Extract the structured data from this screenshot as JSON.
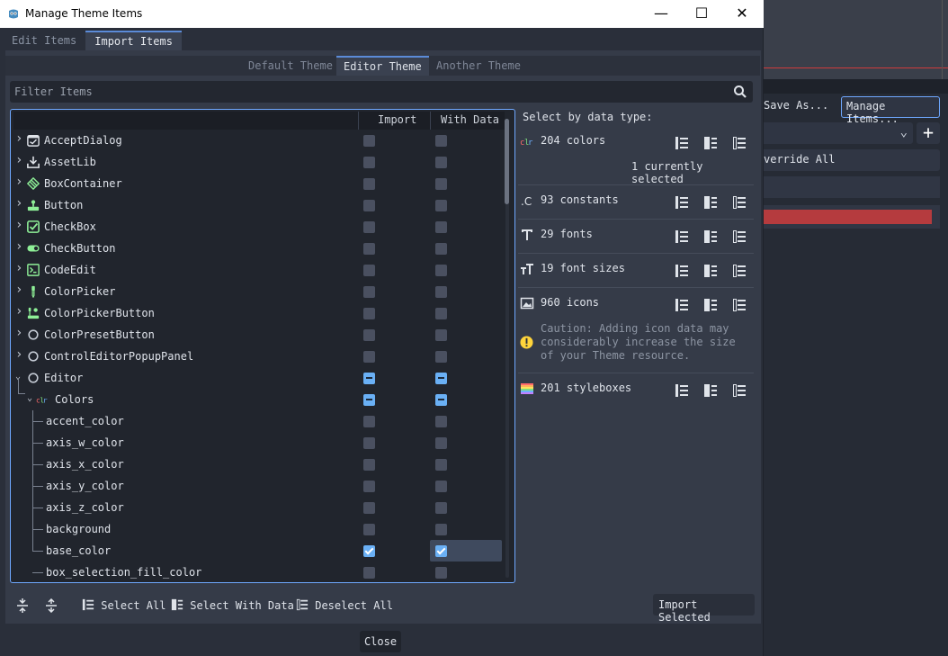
{
  "window": {
    "title": "Manage Theme Items"
  },
  "main_tabs": [
    {
      "label": "Edit Items",
      "active": false
    },
    {
      "label": "Import Items",
      "active": true
    }
  ],
  "theme_tabs": [
    {
      "label": "Default Theme",
      "active": false
    },
    {
      "label": "Editor Theme",
      "active": true
    },
    {
      "label": "Another Theme",
      "active": false
    }
  ],
  "filter": {
    "placeholder": "Filter Items"
  },
  "tree": {
    "columns": {
      "import": "Import",
      "with_data": "With Data"
    },
    "rows": [
      {
        "label": "AcceptDialog",
        "icon": "accept-dialog-icon",
        "import": "unchecked",
        "with_data": "unchecked"
      },
      {
        "label": "AssetLib",
        "icon": "asset-lib-icon",
        "import": "unchecked",
        "with_data": "unchecked"
      },
      {
        "label": "BoxContainer",
        "icon": "box-container-icon",
        "import": "unchecked",
        "with_data": "unchecked"
      },
      {
        "label": "Button",
        "icon": "button-icon",
        "import": "unchecked",
        "with_data": "unchecked"
      },
      {
        "label": "CheckBox",
        "icon": "checkbox-icon",
        "import": "unchecked",
        "with_data": "unchecked"
      },
      {
        "label": "CheckButton",
        "icon": "check-button-icon",
        "import": "unchecked",
        "with_data": "unchecked"
      },
      {
        "label": "CodeEdit",
        "icon": "code-edit-icon",
        "import": "unchecked",
        "with_data": "unchecked"
      },
      {
        "label": "ColorPicker",
        "icon": "color-picker-icon",
        "import": "unchecked",
        "with_data": "unchecked"
      },
      {
        "label": "ColorPickerButton",
        "icon": "color-picker-button-icon",
        "import": "unchecked",
        "with_data": "unchecked"
      },
      {
        "label": "ColorPresetButton",
        "icon": "circle-icon",
        "import": "unchecked",
        "with_data": "unchecked"
      },
      {
        "label": "ControlEditorPopupPanel",
        "icon": "circle-icon",
        "import": "unchecked",
        "with_data": "unchecked"
      },
      {
        "label": "Editor",
        "icon": "circle-icon",
        "import": "mixed",
        "with_data": "mixed"
      },
      {
        "label": "Colors",
        "icon": "colors-icon",
        "import": "mixed",
        "with_data": "mixed"
      },
      {
        "label": "accent_color",
        "import": "unchecked",
        "with_data": "unchecked"
      },
      {
        "label": "axis_w_color",
        "import": "unchecked",
        "with_data": "unchecked"
      },
      {
        "label": "axis_x_color",
        "import": "unchecked",
        "with_data": "unchecked"
      },
      {
        "label": "axis_y_color",
        "import": "unchecked",
        "with_data": "unchecked"
      },
      {
        "label": "axis_z_color",
        "import": "unchecked",
        "with_data": "unchecked"
      },
      {
        "label": "background",
        "import": "unchecked",
        "with_data": "unchecked"
      },
      {
        "label": "base_color",
        "import": "checked",
        "with_data": "checked"
      },
      {
        "label": "box_selection_fill_color",
        "import": "unchecked",
        "with_data": "unchecked"
      }
    ]
  },
  "select_by_type": {
    "heading": "Select by data type:",
    "colors": "204 colors",
    "colors_selected": "1 currently selected",
    "constants": "93 constants",
    "fonts": "29 fonts",
    "font_sizes": "19 font sizes",
    "icons": "960 icons",
    "icons_caution": "Caution: Adding icon data may considerably increase the size of your Theme resource.",
    "styleboxes": "201 styleboxes"
  },
  "footer": {
    "select_all": "Select All",
    "select_with_data": "Select With Data",
    "deselect_all": "Deselect All",
    "import_selected": "Import Selected",
    "close": "Close"
  },
  "background_editor": {
    "save_as": "Save As...",
    "manage_items": "Manage Items...",
    "override_all": "verride All"
  },
  "colors": {
    "accent": "#6fa8ff",
    "red": "#b53b3e",
    "checked": "#6ab0f5"
  }
}
